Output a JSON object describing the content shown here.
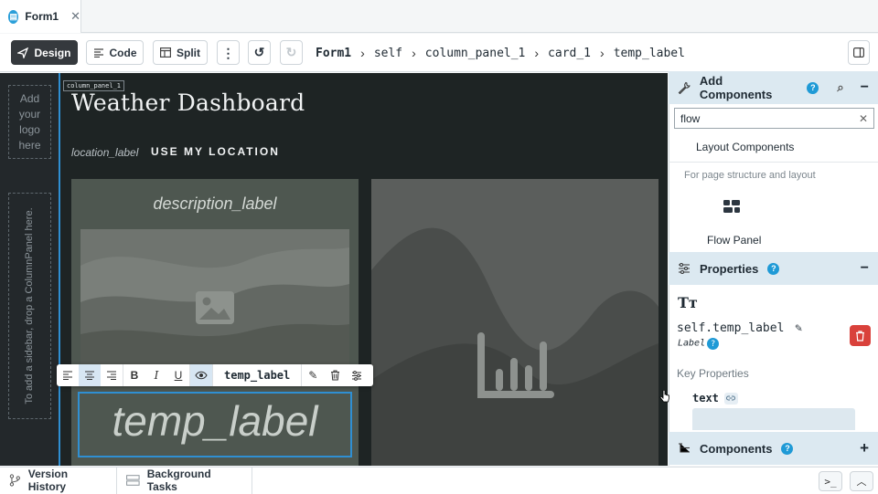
{
  "tab": {
    "label": "Form1"
  },
  "toolbar": {
    "design": "Design",
    "code": "Code",
    "split": "Split",
    "breadcrumb": [
      "Form1",
      "self",
      "column_panel_1",
      "card_1",
      "temp_label"
    ]
  },
  "sidebar": {
    "logo_placeholder": "Add your logo here",
    "drop_hint": "To add a sidebar, drop a ColumnPanel here."
  },
  "canvas": {
    "panel_tag": "column_panel_1",
    "title": "Weather Dashboard",
    "location_label": "location_label",
    "use_location_button": "USE MY LOCATION",
    "description_label": "description_label",
    "selected_component": "temp_label",
    "temp_label": "temp_label"
  },
  "add_components": {
    "title": "Add Components",
    "search_value": "flow",
    "category": "Layout Components",
    "category_description": "For page structure and layout",
    "result": "Flow Panel"
  },
  "properties": {
    "title": "Properties",
    "component_name": "self.temp_label",
    "component_type": "Label",
    "key_properties": "Key Properties",
    "text_property": "text"
  },
  "components_section": {
    "title": "Components"
  },
  "bottom": {
    "version_history": "Version History",
    "background_tasks": "Background Tasks"
  },
  "colors": {
    "accent": "#2f8fd2",
    "help": "#1f9ad6",
    "delete": "#d9413b",
    "canvas_bg": "#1e2424"
  }
}
